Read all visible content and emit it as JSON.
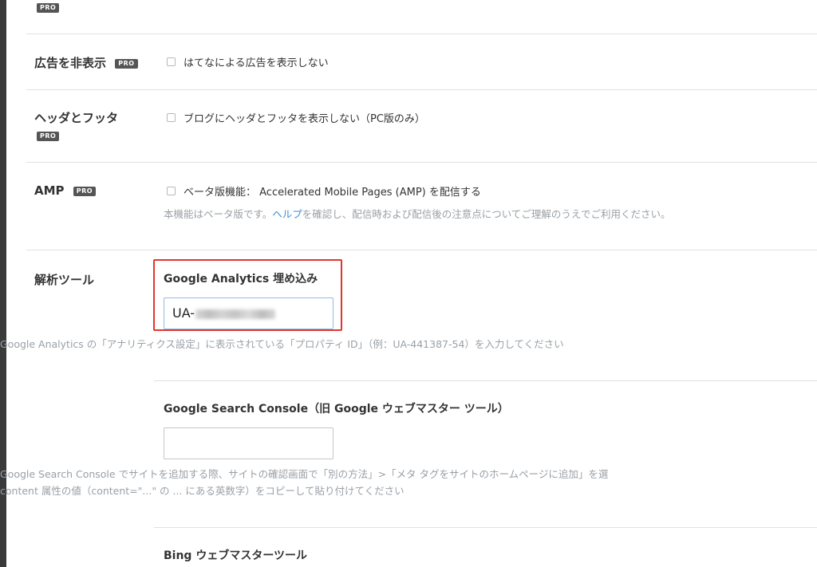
{
  "top_pro_badge": "PRO",
  "rows": {
    "ads": {
      "label": "広告を非表示",
      "pro": "PRO",
      "checkbox_label": "はてなによる広告を表示しない"
    },
    "header_footer": {
      "label": "ヘッダとフッタ",
      "pro": "PRO",
      "checkbox_label": "ブログにヘッダとフッタを表示しない（PC版のみ）"
    },
    "amp": {
      "label": "AMP",
      "pro": "PRO",
      "checkbox_label": "ベータ版機能： Accelerated Mobile Pages (AMP) を配信する",
      "help_before": "本機能はベータ版です。",
      "help_link": "ヘルプ",
      "help_after": "を確認し、配信時および配信後の注意点についてご理解のうえでご利用ください。"
    },
    "analytics": {
      "label": "解析ツール",
      "ga": {
        "title": "Google Analytics 埋め込み",
        "value_prefix": "UA-",
        "help": "Google Analytics の「アナリティクス設定」に表示されている「プロパティ ID」（例：UA-441387-54）を入力してください"
      },
      "gsc": {
        "title": "Google Search Console（旧 Google ウェブマスター ツール）",
        "value": "",
        "help_line1": "Google Search Console でサイトを追加する際、サイトの確認画面で「別の方法」>「メタ タグをサイトのホームページに追加」を選",
        "help_line2": "content 属性の値（content=\"...\" の ... にある英数字）をコピーして貼り付けてください"
      },
      "bing": {
        "title": "Bing ウェブマスターツール"
      }
    }
  },
  "colors": {
    "highlight": "#e0372b",
    "link": "#3a8fd8",
    "help_text": "#9aa0a6",
    "pro_badge": "#555555"
  }
}
